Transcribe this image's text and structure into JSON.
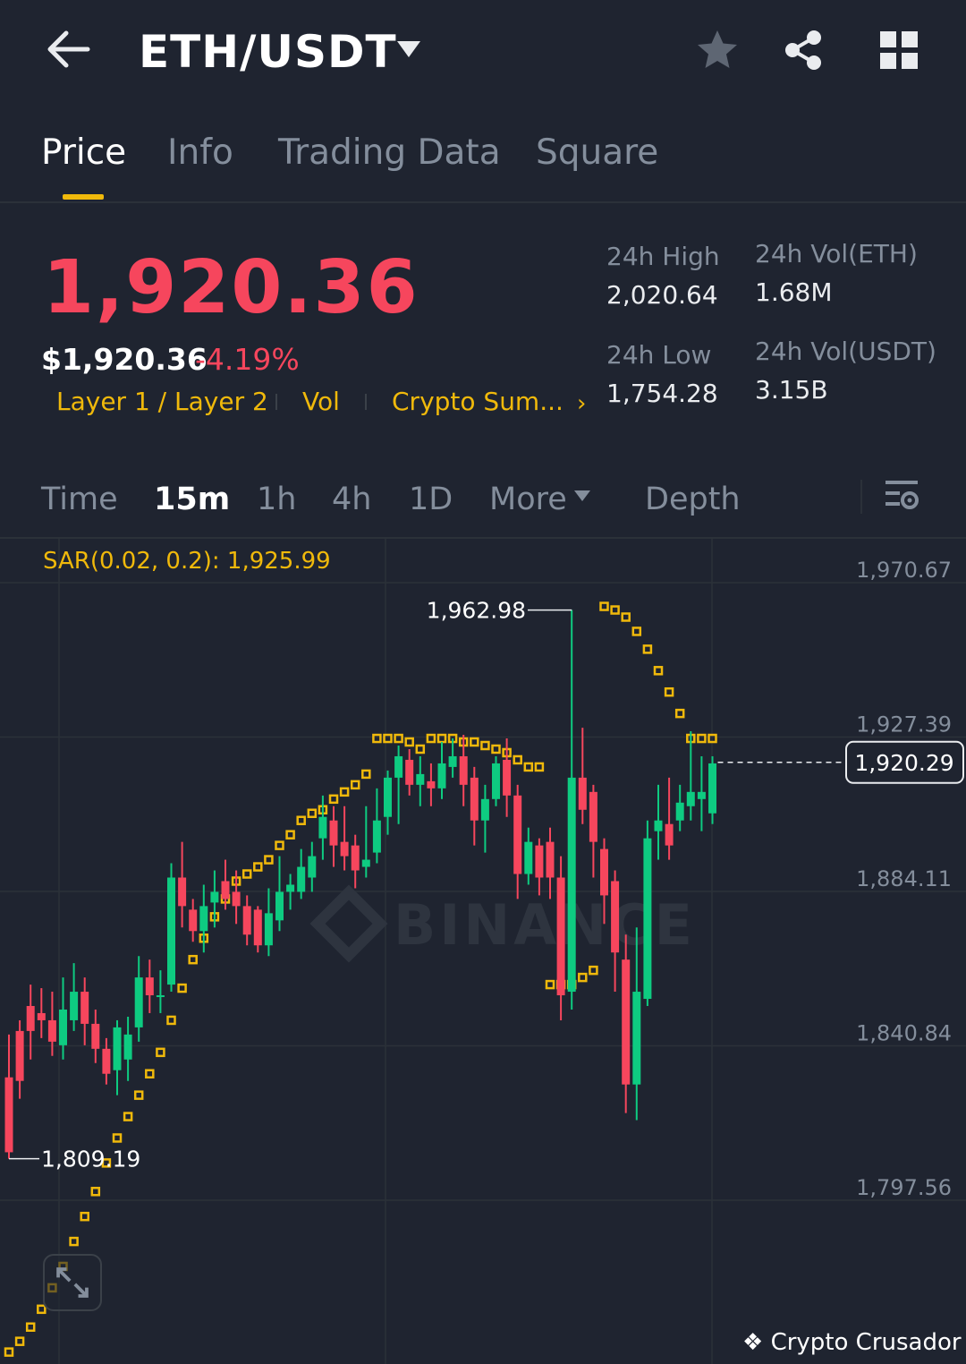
{
  "header": {
    "pair": "ETH/USDT",
    "icons": [
      "back-arrow-icon",
      "caret-down-icon",
      "star-icon",
      "share-icon",
      "grid-icon"
    ]
  },
  "tabs": [
    {
      "label": "Price",
      "active": true
    },
    {
      "label": "Info",
      "active": false
    },
    {
      "label": "Trading Data",
      "active": false
    },
    {
      "label": "Square",
      "active": false
    }
  ],
  "price": {
    "last": "1,920.36",
    "usd": "$1,920.36",
    "change": "-4.19%",
    "tags": [
      "Layer 1 / Layer 2",
      "Vol",
      "Crypto Sum..."
    ]
  },
  "stats": {
    "high_label": "24h High",
    "high_value": "2,020.64",
    "low_label": "24h Low",
    "low_value": "1,754.28",
    "vol_base_label": "24h Vol(ETH)",
    "vol_base_value": "1.68M",
    "vol_quote_label": "24h Vol(USDT)",
    "vol_quote_value": "3.15B"
  },
  "intervals": [
    {
      "label": "Time",
      "active": false
    },
    {
      "label": "15m",
      "active": true
    },
    {
      "label": "1h",
      "active": false
    },
    {
      "label": "4h",
      "active": false
    },
    {
      "label": "1D",
      "active": false
    },
    {
      "label": "More",
      "active": false
    },
    {
      "label": "Depth",
      "active": false
    }
  ],
  "colors": {
    "background": "#1f2430",
    "up": "#0ecb81",
    "down": "#f6465d",
    "accent": "#f0b90b",
    "muted": "#848e9c"
  },
  "watermark": {
    "text": "Crypto Crusador",
    "brand": "BINANCE"
  },
  "chart_data": {
    "type": "candlestick",
    "indicator_label": "SAR(0.02, 0.2): 1,925.99",
    "y_ticks": [
      "1,970.67",
      "1,927.39",
      "1,884.11",
      "1,840.84",
      "1,797.56"
    ],
    "y_tick_values": [
      1970.67,
      1927.39,
      1884.11,
      1840.84,
      1797.56
    ],
    "ylim": [
      1754.28,
      1970.67
    ],
    "current_price_label": "1,920.29",
    "current_price": 1920.29,
    "high_marker_label": "1,962.98",
    "high_marker": 1962.98,
    "low_marker_label": "1,809.19",
    "low_marker": 1809.19,
    "candles": [
      [
        1832,
        1811,
        1844,
        1809.19
      ],
      [
        1845,
        1831,
        1848,
        1826
      ],
      [
        1852,
        1845,
        1858,
        1837
      ],
      [
        1850,
        1848,
        1857,
        1843
      ],
      [
        1848,
        1842,
        1856,
        1838
      ],
      [
        1841,
        1851,
        1860,
        1837
      ],
      [
        1848,
        1856,
        1864,
        1845
      ],
      [
        1856,
        1847,
        1860,
        1841
      ],
      [
        1847,
        1840,
        1851,
        1836
      ],
      [
        1840,
        1833,
        1843,
        1830
      ],
      [
        1834,
        1846,
        1848,
        1827
      ],
      [
        1837,
        1844,
        1849,
        1831
      ],
      [
        1846,
        1860,
        1866,
        1842
      ],
      [
        1860,
        1855,
        1865,
        1850
      ],
      [
        1855,
        1855,
        1862,
        1850
      ],
      [
        1858,
        1888,
        1892,
        1856
      ],
      [
        1888,
        1880,
        1898,
        1874
      ],
      [
        1879,
        1873,
        1882,
        1870
      ],
      [
        1873,
        1880,
        1886,
        1867
      ],
      [
        1881,
        1884,
        1890,
        1874
      ],
      [
        1887,
        1882,
        1893,
        1879
      ],
      [
        1884,
        1880,
        1890,
        1875
      ],
      [
        1880,
        1872,
        1883,
        1869
      ],
      [
        1879,
        1869,
        1880,
        1867
      ],
      [
        1869,
        1878,
        1885,
        1866
      ],
      [
        1876,
        1884,
        1894,
        1873
      ],
      [
        1884,
        1886,
        1889,
        1879
      ],
      [
        1884,
        1891,
        1896,
        1882
      ],
      [
        1888,
        1894,
        1898,
        1884
      ],
      [
        1899,
        1905,
        1911,
        1893
      ],
      [
        1904,
        1897,
        1908,
        1891
      ],
      [
        1898,
        1894,
        1908,
        1890
      ],
      [
        1897,
        1890,
        1900,
        1885
      ],
      [
        1891,
        1893,
        1908,
        1888
      ],
      [
        1895,
        1904,
        1913,
        1892
      ],
      [
        1905,
        1916,
        1918,
        1900
      ],
      [
        1916,
        1922,
        1925,
        1903
      ],
      [
        1921,
        1914,
        1924,
        1911
      ],
      [
        1914,
        1917,
        1922,
        1908
      ],
      [
        1915,
        1913,
        1920,
        1908
      ],
      [
        1913,
        1920,
        1926,
        1910
      ],
      [
        1919,
        1922,
        1927,
        1916
      ],
      [
        1922,
        1914,
        1928,
        1908
      ],
      [
        1916,
        1904,
        1919,
        1897
      ],
      [
        1904,
        1910,
        1914,
        1895
      ],
      [
        1910,
        1920,
        1922,
        1908
      ],
      [
        1921,
        1911,
        1927,
        1905
      ],
      [
        1911,
        1889,
        1914,
        1882
      ],
      [
        1889,
        1898,
        1902,
        1886
      ],
      [
        1897,
        1888,
        1899,
        1883
      ],
      [
        1898,
        1888,
        1902,
        1882
      ],
      [
        1888,
        1855,
        1894,
        1848
      ],
      [
        1856,
        1916,
        1963,
        1851
      ],
      [
        1916,
        1907,
        1930,
        1903
      ],
      [
        1912,
        1898,
        1914,
        1888
      ],
      [
        1896,
        1883,
        1899,
        1875
      ],
      [
        1887,
        1867,
        1890,
        1856
      ],
      [
        1865,
        1830,
        1872,
        1822
      ],
      [
        1830,
        1856,
        1874,
        1820
      ],
      [
        1854,
        1899,
        1904,
        1852
      ],
      [
        1901,
        1904,
        1914,
        1893
      ],
      [
        1903,
        1897,
        1916,
        1893
      ],
      [
        1904,
        1909,
        1914,
        1901
      ],
      [
        1908,
        1912,
        1929,
        1904
      ],
      [
        1910,
        1912,
        1922,
        1901
      ],
      [
        1906,
        1920,
        1922,
        1903
      ]
    ],
    "sar": [
      1755,
      1758,
      1762,
      1767,
      1773,
      1779,
      1786,
      1793,
      1800,
      1808,
      1815,
      1821,
      1827,
      1833,
      1839,
      1848,
      1857,
      1865,
      1871,
      1877,
      1882,
      1887,
      1889,
      1891,
      1893,
      1897,
      1900,
      1904,
      1906,
      1907,
      1910,
      1912,
      1914,
      1917,
      1927,
      1927,
      1927,
      1926,
      1924,
      1927,
      1927,
      1927,
      1926,
      1926,
      1925,
      1924,
      1923,
      1921,
      1919,
      1919,
      1858,
      1858,
      1858,
      1860,
      1862,
      1964,
      1963,
      1961,
      1957,
      1952,
      1946,
      1940,
      1934,
      1927,
      1927,
      1927
    ]
  }
}
